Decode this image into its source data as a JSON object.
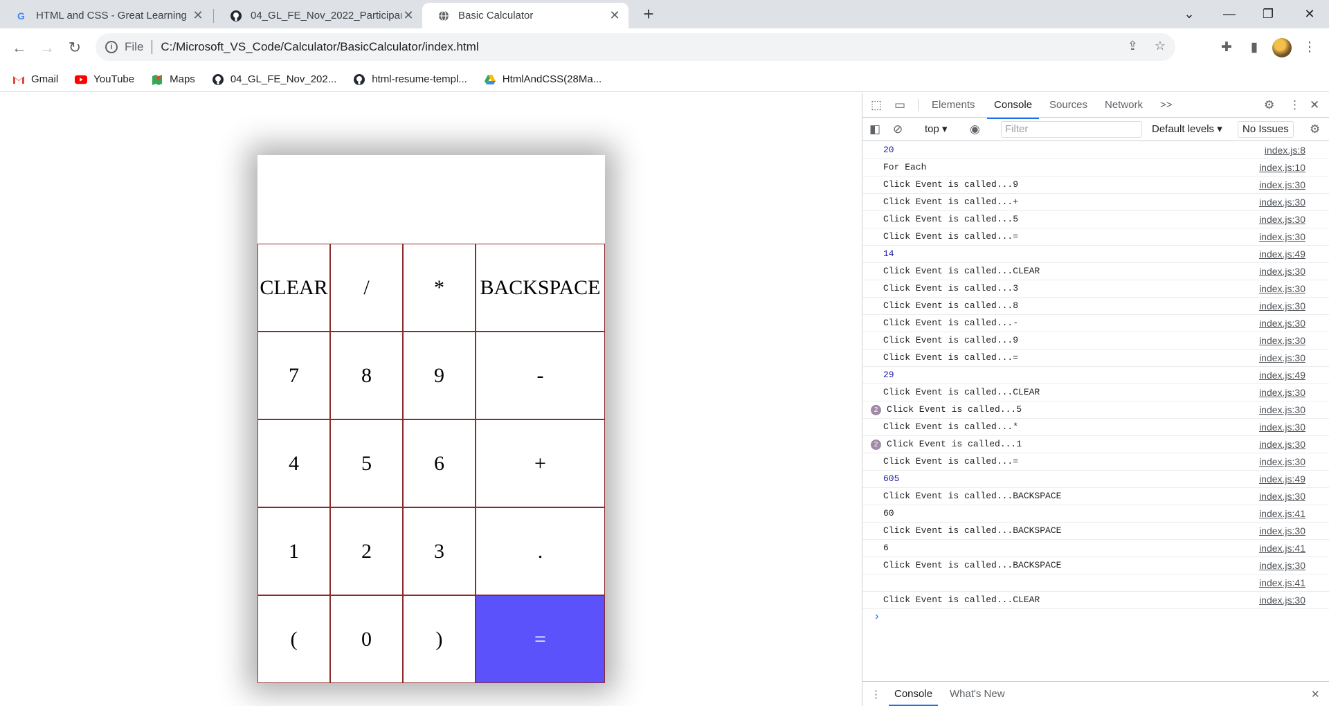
{
  "browser": {
    "tabs": [
      {
        "title": "HTML and CSS - Great Learning",
        "icon": "google-icon"
      },
      {
        "title": "04_GL_FE_Nov_2022_Participants",
        "icon": "github-icon"
      },
      {
        "title": "Basic Calculator",
        "icon": "globe-icon",
        "active": true
      }
    ],
    "address": {
      "scheme_label": "File",
      "url": "C:/Microsoft_VS_Code/Calculator/BasicCalculator/index.html"
    },
    "bookmarks": [
      {
        "label": "Gmail",
        "icon": "gmail-icon"
      },
      {
        "label": "YouTube",
        "icon": "youtube-icon"
      },
      {
        "label": "Maps",
        "icon": "maps-icon"
      },
      {
        "label": "04_GL_FE_Nov_202...",
        "icon": "github-icon"
      },
      {
        "label": "html-resume-templ...",
        "icon": "github-icon"
      },
      {
        "label": "HtmlAndCSS(28Ma...",
        "icon": "drive-icon"
      }
    ]
  },
  "calculator": {
    "display": "",
    "keys": [
      "CLEAR",
      "/",
      "*",
      "BACKSPACE",
      "7",
      "8",
      "9",
      "-",
      "4",
      "5",
      "6",
      "+",
      "1",
      "2",
      "3",
      ".",
      "(",
      "0",
      ")",
      "="
    ],
    "equals_color": "#5b52fb",
    "border_color": "#8b2a2a"
  },
  "devtools": {
    "tabs": [
      "Elements",
      "Console",
      "Sources",
      "Network"
    ],
    "active_tab": "Console",
    "more": ">>",
    "context": "top",
    "filter_placeholder": "Filter",
    "levels": "Default levels",
    "issues": "No Issues",
    "logs": [
      {
        "msg": "20",
        "src": "index.js:8",
        "num": true
      },
      {
        "msg": "For Each",
        "src": "index.js:10"
      },
      {
        "msg": "Click Event is called...9",
        "src": "index.js:30"
      },
      {
        "msg": "Click Event is called...+",
        "src": "index.js:30"
      },
      {
        "msg": "Click Event is called...5",
        "src": "index.js:30"
      },
      {
        "msg": "Click Event is called...=",
        "src": "index.js:30"
      },
      {
        "msg": "14",
        "src": "index.js:49",
        "num": true
      },
      {
        "msg": "Click Event is called...CLEAR",
        "src": "index.js:30"
      },
      {
        "msg": "Click Event is called...3",
        "src": "index.js:30"
      },
      {
        "msg": "Click Event is called...8",
        "src": "index.js:30"
      },
      {
        "msg": "Click Event is called...-",
        "src": "index.js:30"
      },
      {
        "msg": "Click Event is called...9",
        "src": "index.js:30"
      },
      {
        "msg": "Click Event is called...=",
        "src": "index.js:30"
      },
      {
        "msg": "29",
        "src": "index.js:49",
        "num": true
      },
      {
        "msg": "Click Event is called...CLEAR",
        "src": "index.js:30"
      },
      {
        "msg": "Click Event is called...5",
        "src": "index.js:30",
        "repeat": "2"
      },
      {
        "msg": "Click Event is called...*",
        "src": "index.js:30"
      },
      {
        "msg": "Click Event is called...1",
        "src": "index.js:30",
        "repeat": "2"
      },
      {
        "msg": "Click Event is called...=",
        "src": "index.js:30"
      },
      {
        "msg": "605",
        "src": "index.js:49",
        "num": true
      },
      {
        "msg": "Click Event is called...BACKSPACE",
        "src": "index.js:30"
      },
      {
        "msg": "60",
        "src": "index.js:41"
      },
      {
        "msg": "Click Event is called...BACKSPACE",
        "src": "index.js:30"
      },
      {
        "msg": "6",
        "src": "index.js:41"
      },
      {
        "msg": "Click Event is called...BACKSPACE",
        "src": "index.js:30"
      },
      {
        "msg": "",
        "src": "index.js:41"
      },
      {
        "msg": "Click Event is called...CLEAR",
        "src": "index.js:30"
      }
    ],
    "prompt": "›",
    "drawer_tabs": [
      "Console",
      "What's New"
    ]
  }
}
